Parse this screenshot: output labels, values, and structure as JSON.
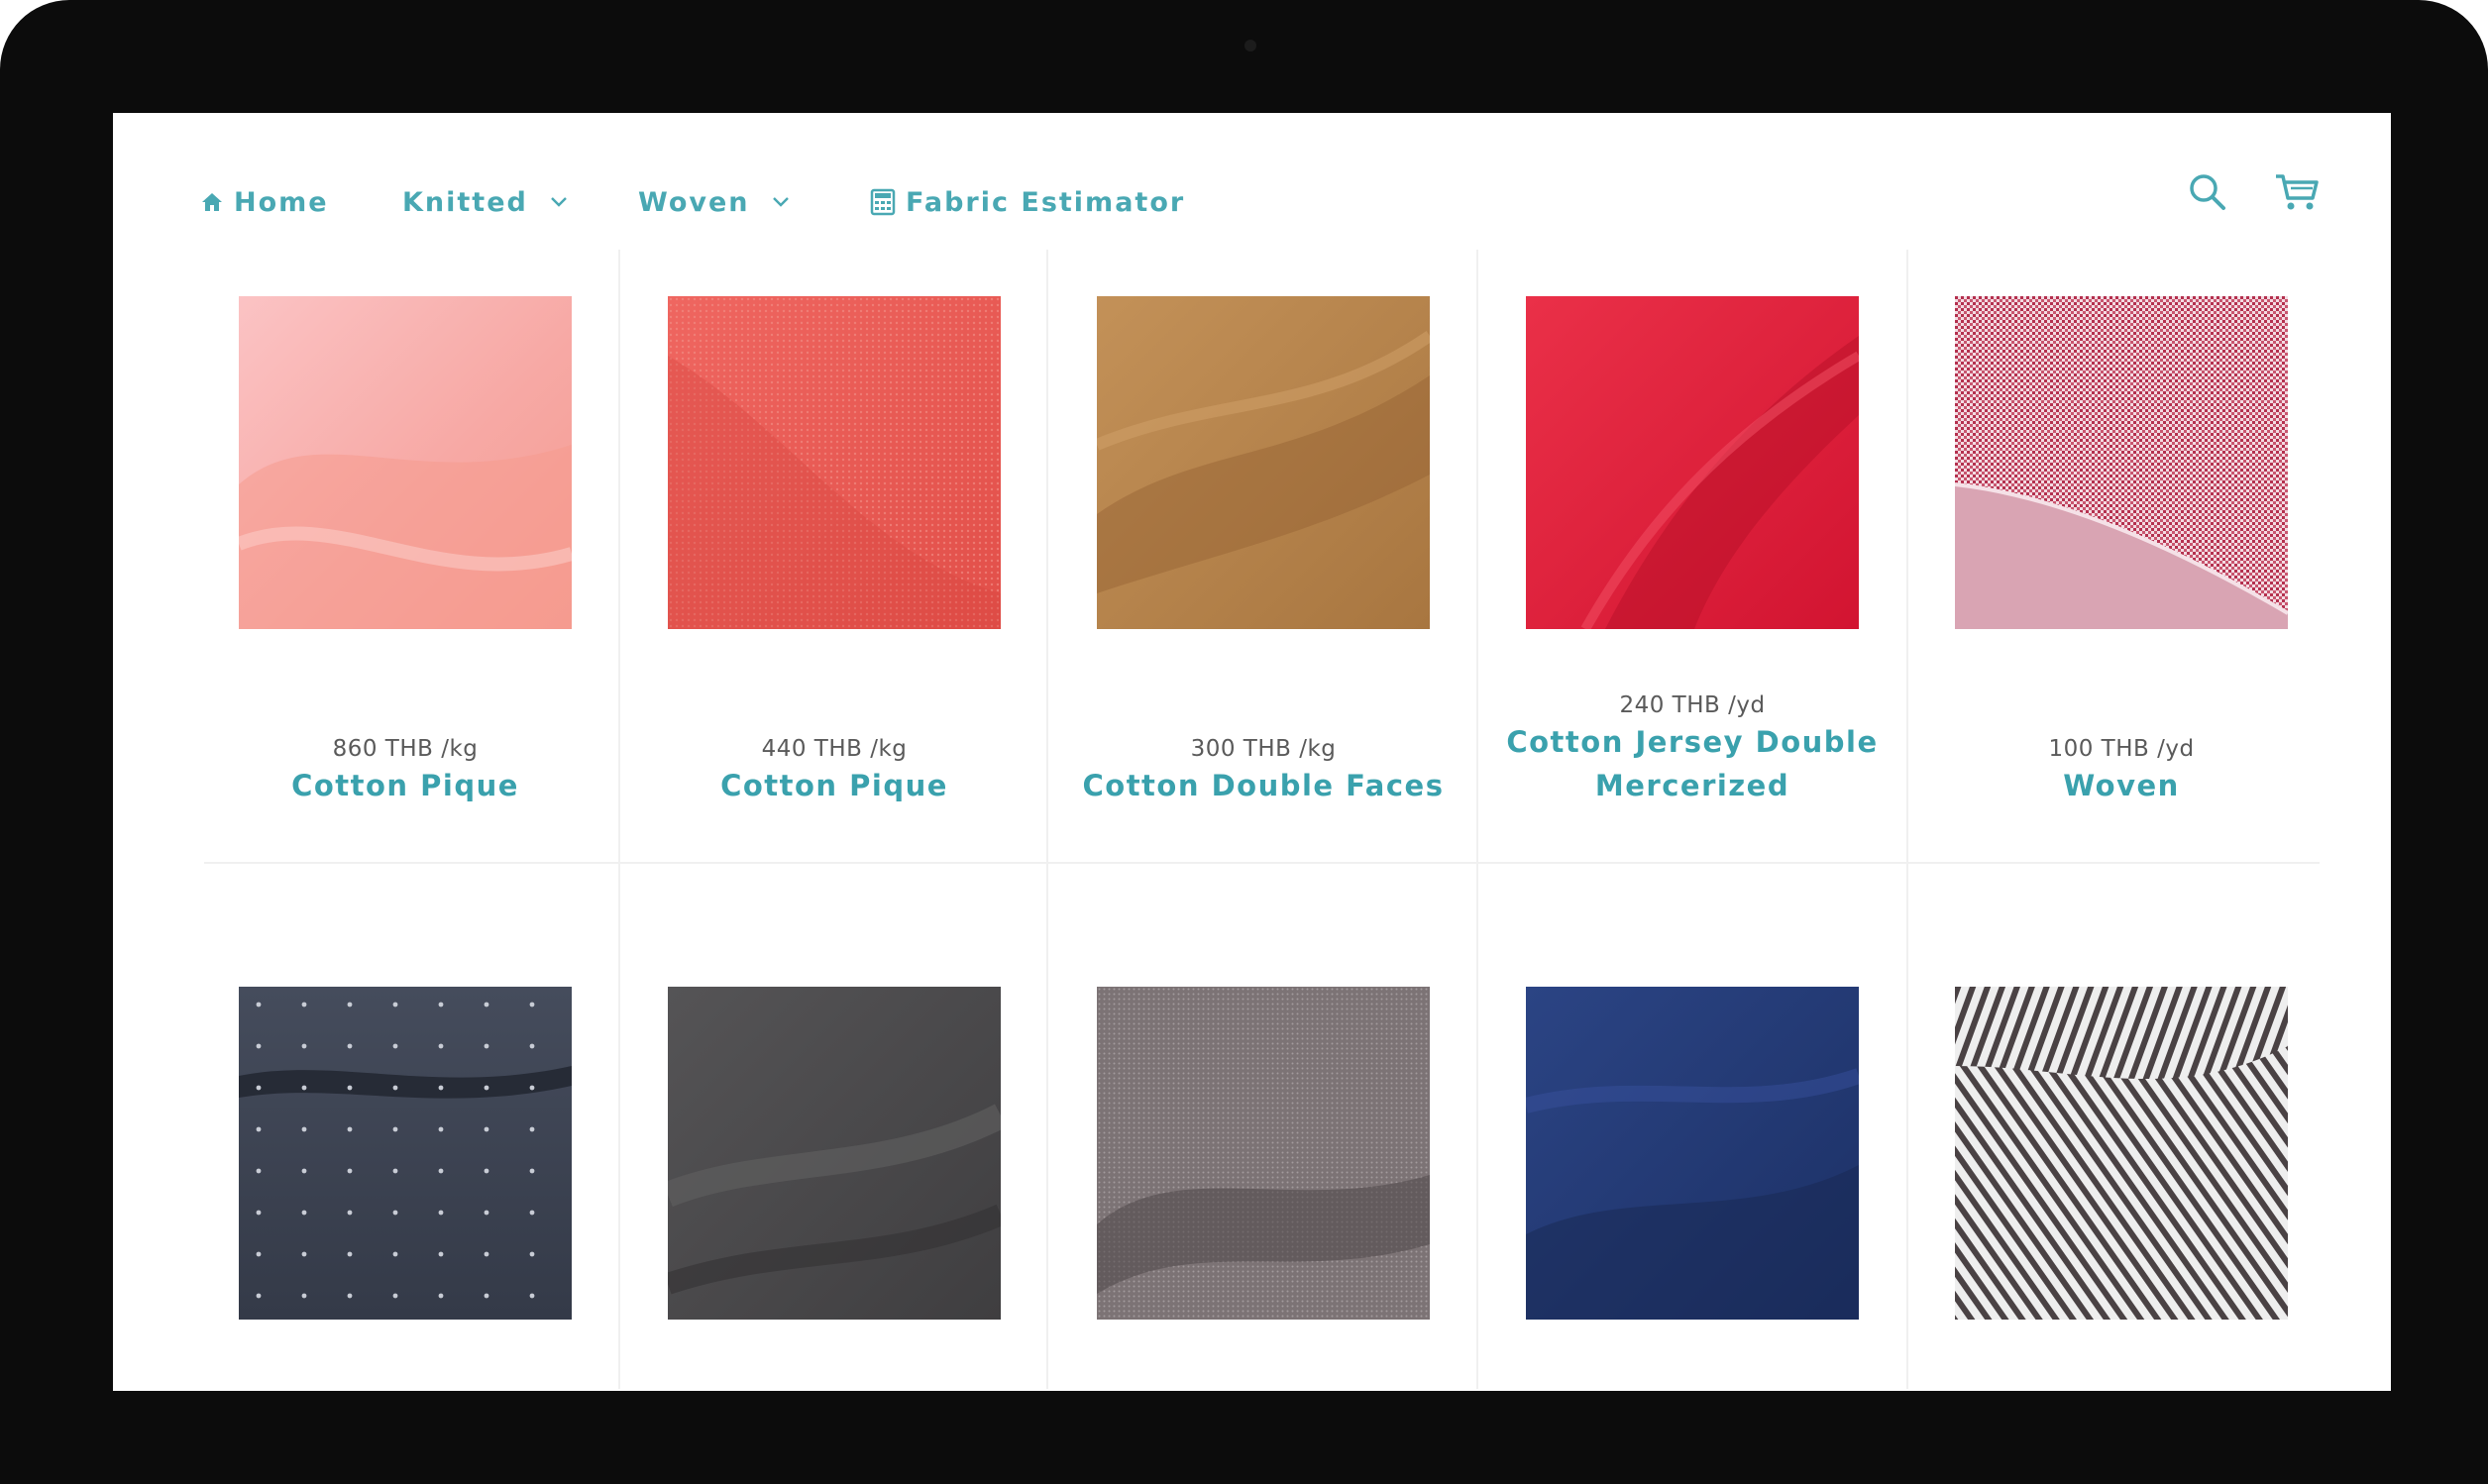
{
  "nav": {
    "items": [
      {
        "label": "Home",
        "icon": "home-icon"
      },
      {
        "label": "Knitted",
        "icon": "chevron-down-icon"
      },
      {
        "label": "Woven",
        "icon": "chevron-down-icon"
      },
      {
        "label": "Fabric Estimator",
        "icon": "calculator-icon"
      }
    ],
    "search_icon": "search-icon",
    "cart_icon": "cart-icon"
  },
  "colors": {
    "accent": "#49a8b3",
    "price_text": "#5a5a5a",
    "bezel": "#0c0c0c"
  },
  "products": [
    {
      "price": "860 THB /kg",
      "name": "Cotton Pique",
      "swatch_color": "#f7a9a5"
    },
    {
      "price": "440 THB /kg",
      "name": "Cotton Pique",
      "swatch_color": "#ec5c56"
    },
    {
      "price": "300 THB /kg",
      "name": "Cotton Double Faces",
      "swatch_color": "#b78348"
    },
    {
      "price": "240 THB /yd",
      "name_line1": "Cotton Jersey Double",
      "name_line2": "Mercerized",
      "swatch_color": "#e0203a"
    },
    {
      "price": "100 THB /yd",
      "name": "Woven",
      "swatch_color": "#d9a4b3"
    },
    {
      "swatch_color": "#3a4151"
    },
    {
      "swatch_color": "#4b4a4b"
    },
    {
      "swatch_color": "#7c7375"
    },
    {
      "swatch_color": "#233a72"
    },
    {
      "swatch_color": "#d7d4d6"
    }
  ]
}
